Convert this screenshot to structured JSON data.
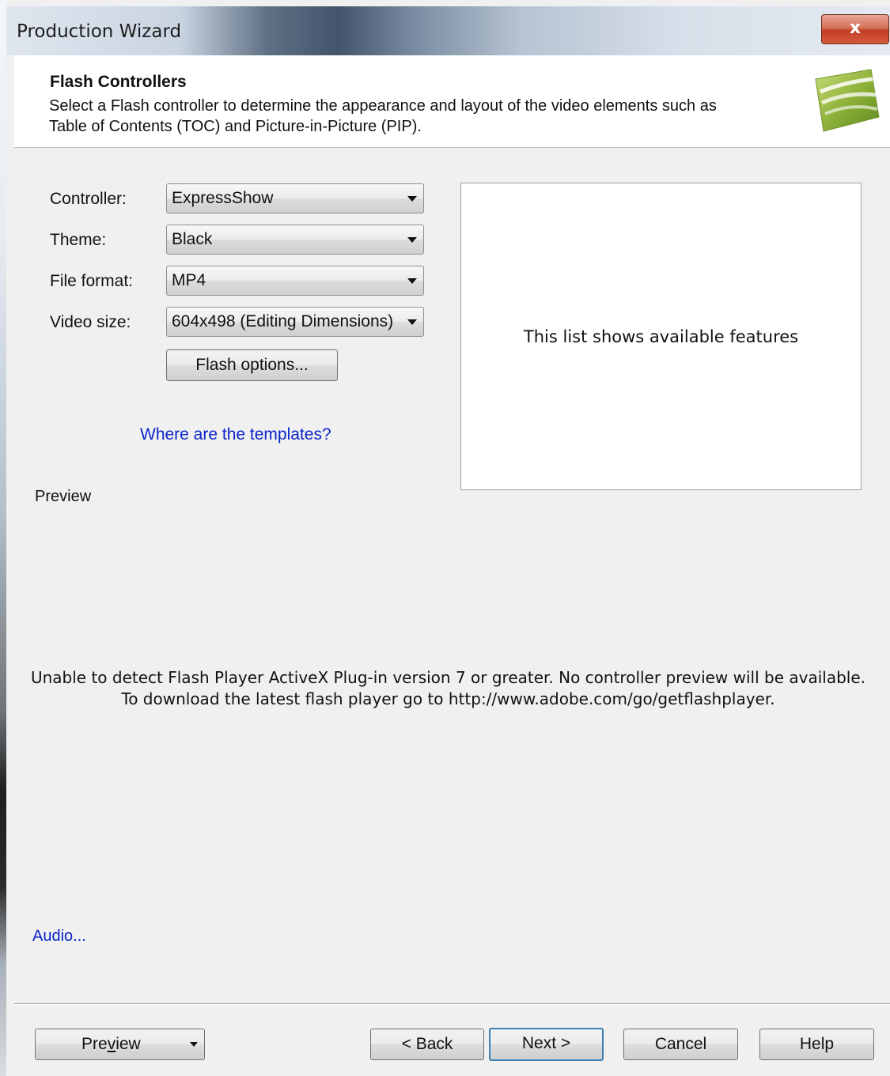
{
  "window": {
    "title": "Production Wizard",
    "close_label": "x"
  },
  "header": {
    "title": "Flash Controllers",
    "description": "Select a Flash controller to determine the appearance and layout of the video elements such as Table of Contents (TOC) and Picture-in-Picture (PIP).",
    "logo_icon": "wizard-logo-icon"
  },
  "form": {
    "controller_label": "Controller:",
    "controller_value": "ExpressShow",
    "theme_label": "Theme:",
    "theme_value": "Black",
    "file_format_label": "File format:",
    "file_format_value": "MP4",
    "video_size_label": "Video size:",
    "video_size_value": "604x498 (Editing Dimensions)",
    "flash_options_label": "Flash options...",
    "templates_link": "Where are the templates?"
  },
  "features": {
    "placeholder": "This list shows available features"
  },
  "preview": {
    "label": "Preview",
    "message_line1": "Unable to detect Flash Player ActiveX Plug-in version 7 or greater.  No controller preview will be available.",
    "message_line2": "To download the latest flash player go to http://www.adobe.com/go/getflashplayer."
  },
  "audio_link": "Audio...",
  "footer": {
    "preview_pre": "Pre",
    "preview_underlined": "v",
    "preview_post": "iew",
    "back_label": "< Back",
    "next_label": "Next >",
    "cancel_label": "Cancel",
    "help_label": "Help"
  },
  "colors": {
    "link": "#0b24c9",
    "close_button": "#c23d22",
    "default_button_border": "#3c7fb1",
    "logo_green": "#8fb23a"
  }
}
